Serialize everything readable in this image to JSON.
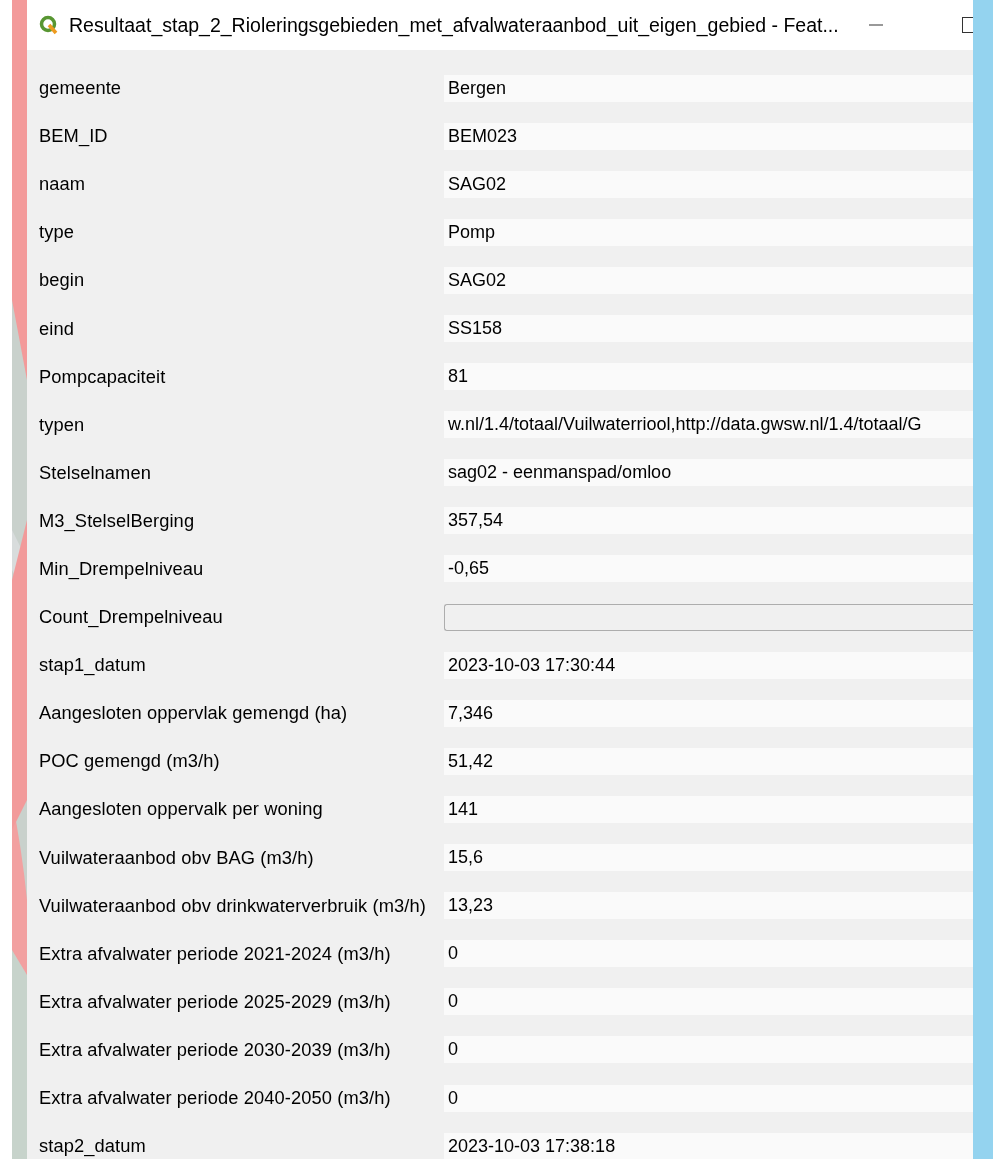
{
  "window": {
    "title": "Resultaat_stap_2_Rioleringsgebieden_met_afvalwateraanbod_uit_eigen_gebied - Feat..."
  },
  "fields": [
    {
      "label": "gemeente",
      "kind": "text",
      "value": "Bergen"
    },
    {
      "label": "BEM_ID",
      "kind": "text",
      "value": "BEM023"
    },
    {
      "label": "naam",
      "kind": "text",
      "value": "SAG02"
    },
    {
      "label": "type",
      "kind": "text",
      "value": "Pomp"
    },
    {
      "label": "begin",
      "kind": "text",
      "value": "SAG02"
    },
    {
      "label": "eind",
      "kind": "text",
      "value": "SS158"
    },
    {
      "label": "Pompcapaciteit",
      "kind": "text",
      "value": "81"
    },
    {
      "label": "typen",
      "kind": "text",
      "value": "w.nl/1.4/totaal/Vuilwaterriool,http://data.gwsw.nl/1.4/totaal/G"
    },
    {
      "label": "Stelselnamen",
      "kind": "text",
      "value": "sag02 - eenmanspad/omloo"
    },
    {
      "label": "M3_StelselBerging",
      "kind": "text",
      "value": "357,54"
    },
    {
      "label": "Min_Drempelniveau",
      "kind": "text",
      "value": "-0,65"
    },
    {
      "label": "Count_Drempelniveau",
      "kind": "input"
    },
    {
      "label": "stap1_datum",
      "kind": "text",
      "value": "2023-10-03 17:30:44"
    },
    {
      "label": "Aangesloten oppervlak gemengd (ha)",
      "kind": "text",
      "value": "7,346"
    },
    {
      "label": "POC gemengd (m3/h)",
      "kind": "text",
      "value": "51,42"
    },
    {
      "label": "Aangesloten oppervalk per woning",
      "kind": "text",
      "value": "141"
    },
    {
      "label": "Vuilwateraanbod obv BAG (m3/h)",
      "kind": "text",
      "value": "15,6"
    },
    {
      "label": "Vuilwateraanbod obv drinkwaterverbruik (m3/h)",
      "kind": "text",
      "value": "13,23"
    },
    {
      "label": "Extra afvalwater periode 2021-2024 (m3/h)",
      "kind": "text",
      "value": "0"
    },
    {
      "label": "Extra afvalwater periode 2025-2029 (m3/h)",
      "kind": "text",
      "value": "0"
    },
    {
      "label": "Extra afvalwater periode 2030-2039 (m3/h)",
      "kind": "text",
      "value": "0"
    },
    {
      "label": "Extra afvalwater periode 2040-2050 (m3/h)",
      "kind": "text",
      "value": "0"
    },
    {
      "label": "stap2_datum",
      "kind": "text",
      "value": "2023-10-03 17:38:18"
    }
  ]
}
